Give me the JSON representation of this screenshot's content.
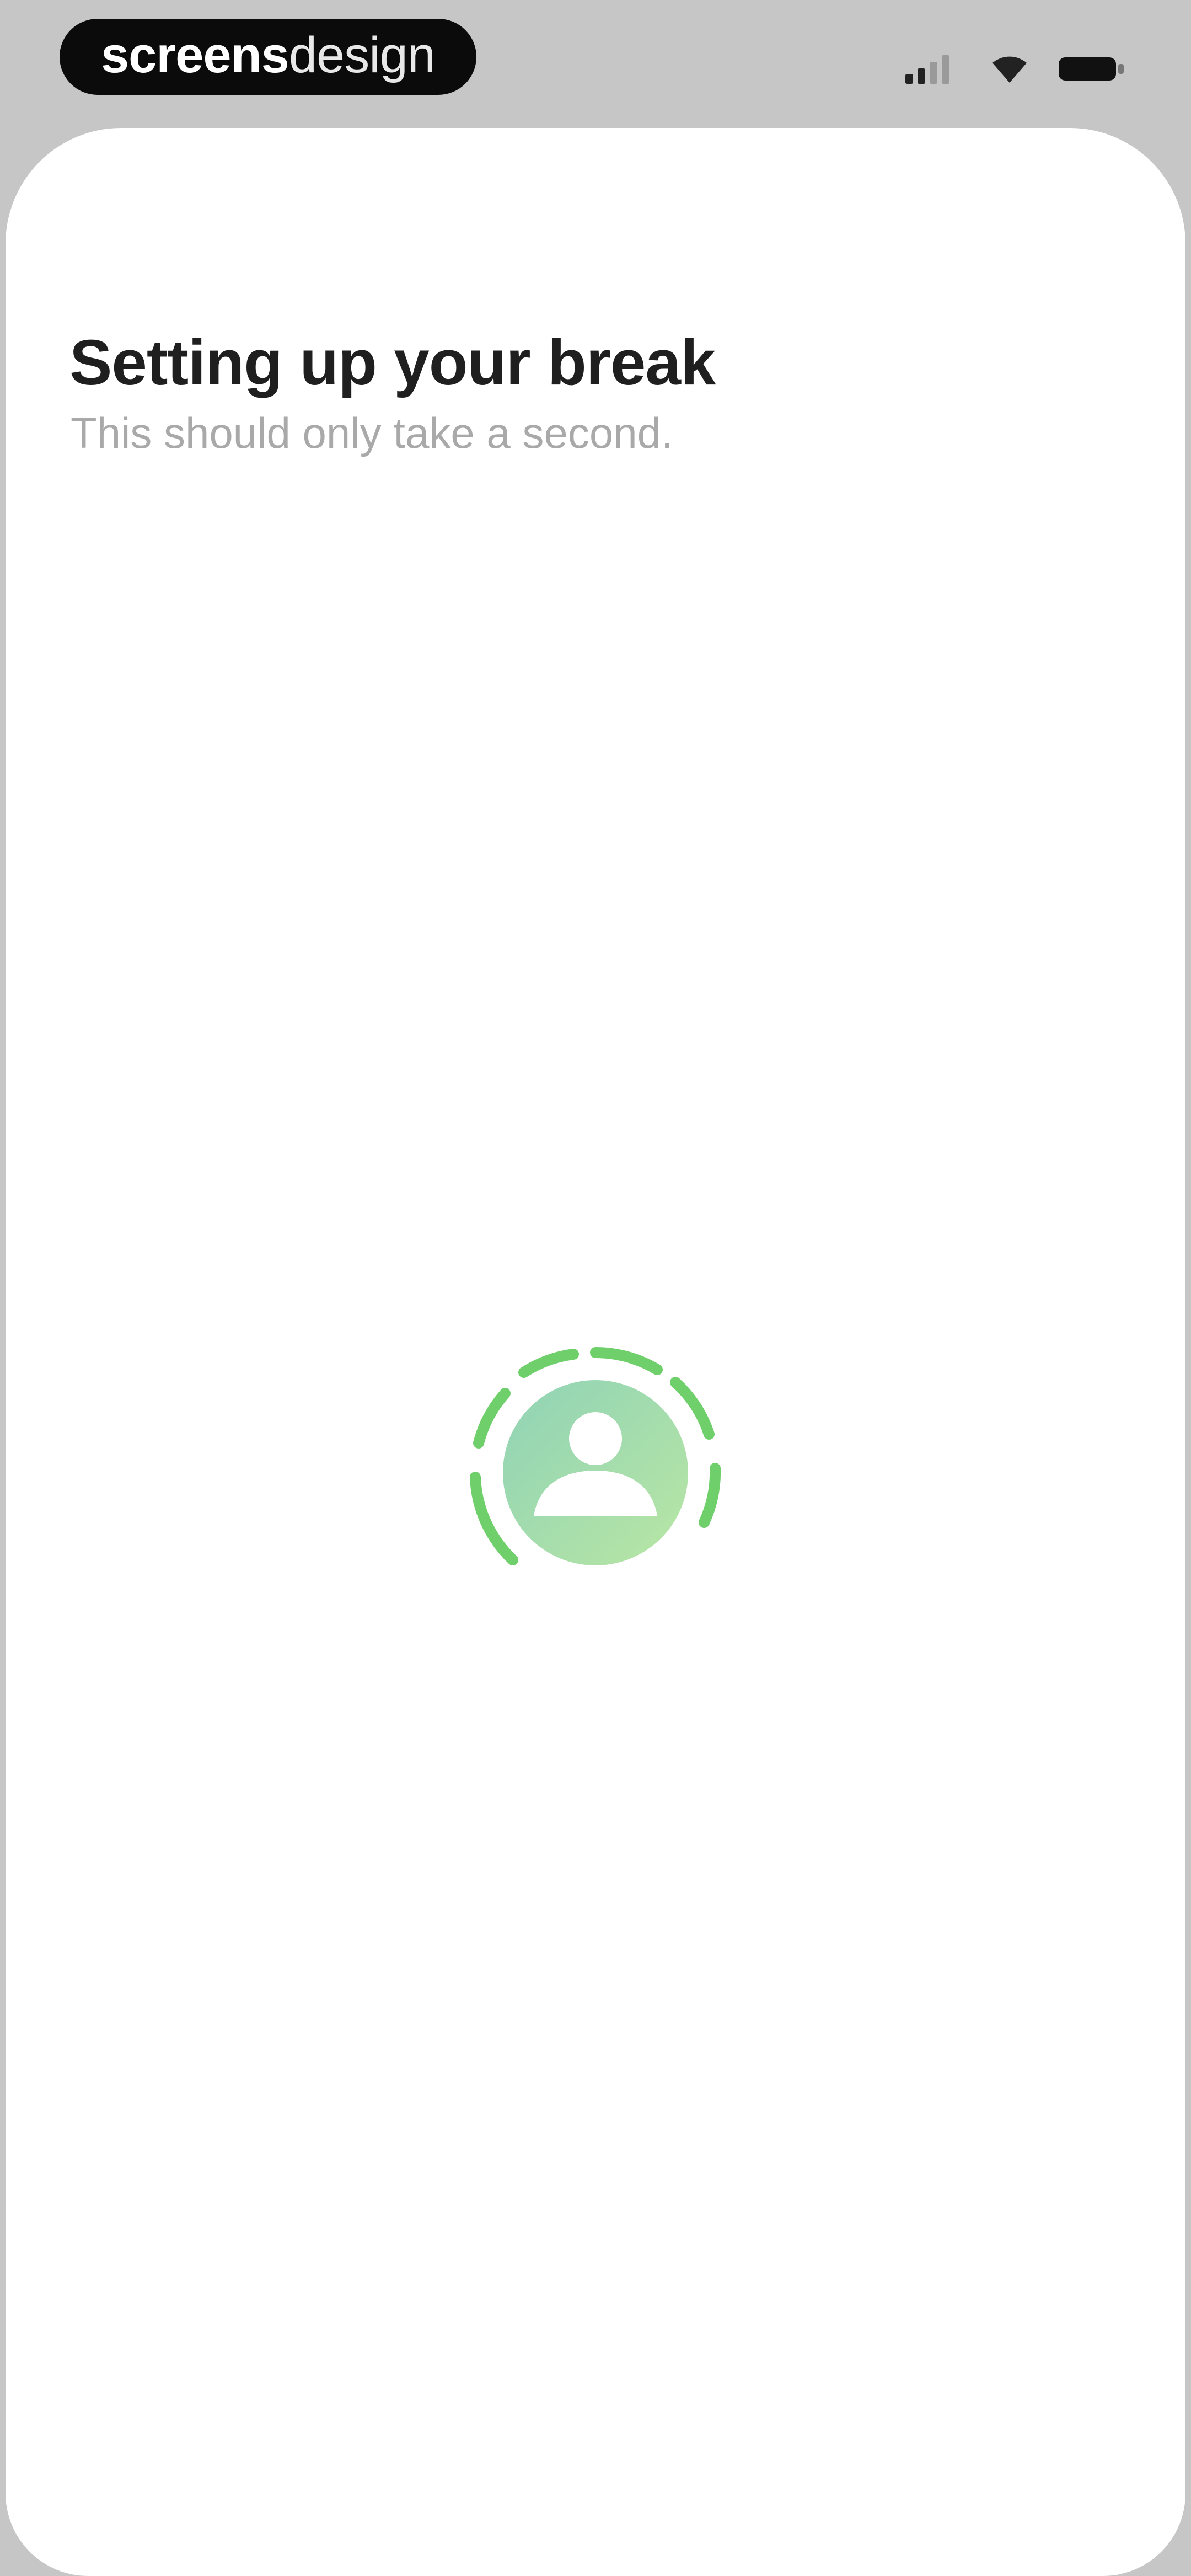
{
  "brand": {
    "bold": "screens",
    "light": "design"
  },
  "status_bar": {
    "icons": [
      "cellular-signal-icon",
      "wifi-icon",
      "battery-icon"
    ]
  },
  "loading": {
    "title": "Setting up your break",
    "subtitle": "This should only take a second.",
    "spinner_icon": "user-avatar-icon"
  },
  "colors": {
    "background": "#c6c6c6",
    "card": "#ffffff",
    "title": "#1f1f1f",
    "subtitle": "#a9a9a9",
    "spinner_ring": "#6fcf6a",
    "avatar_gradient_start": "#8fd3b6",
    "avatar_gradient_end": "#b6e6a6"
  }
}
